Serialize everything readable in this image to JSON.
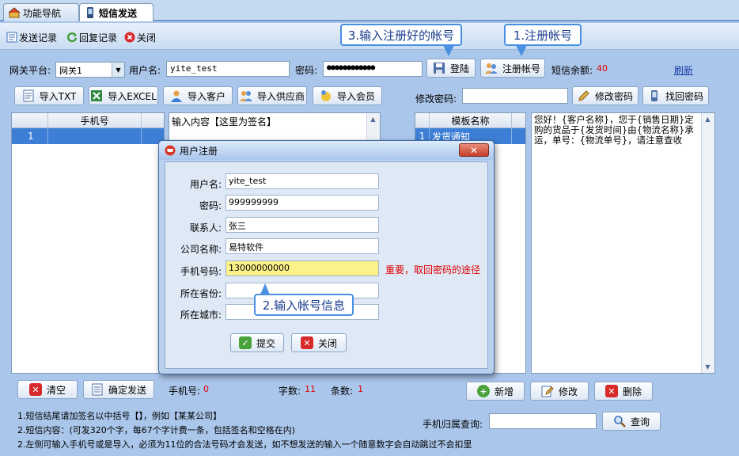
{
  "tabs": [
    {
      "label": "功能导航"
    },
    {
      "label": "短信发送"
    }
  ],
  "toolbar": {
    "send_log": "发送记录",
    "reply_log": "回复记录",
    "close": "关闭"
  },
  "gateway": {
    "label": "网关平台:",
    "value": "网关1",
    "user_label": "用户名:",
    "user_value": "yite_test",
    "pwd_label": "密码:",
    "pwd_value": "●●●●●●●●●●●●",
    "login": "登陆",
    "register": "注册帐号",
    "balance_label": "短信余额:",
    "balance_value": "40",
    "refresh": "刷新"
  },
  "import": {
    "txt": "导入TXT",
    "excel": "导入EXCEL",
    "customer": "导入客户",
    "supplier": "导入供应商",
    "member": "导入会员",
    "change_pwd_label": "修改密码:",
    "change_pwd": "修改密码",
    "find_pwd": "找回密码"
  },
  "phone_grid": {
    "header": "手机号",
    "row_index": "1"
  },
  "content": {
    "placeholder_text": "输入内容【这里为签名】"
  },
  "template_grid": {
    "header": "模板名称",
    "row_index": "1",
    "row_name": "发货通知"
  },
  "template_text": "您好！{客户名称}，您于{销售日期}定购的货品于{发货时间}由{物流名称}承运，单号：{物流单号}，请注意查收",
  "callouts": {
    "c1": "1.注册帐号",
    "c2": "2.输入帐号信息",
    "c3": "3.输入注册好的帐号"
  },
  "dialog": {
    "title": "用户注册",
    "fields": [
      {
        "label": "用户名:",
        "value": "yite_test"
      },
      {
        "label": "密码:",
        "value": "999999999"
      },
      {
        "label": "联系人:",
        "value": "张三"
      },
      {
        "label": "公司名称:",
        "value": "易特软件"
      },
      {
        "label": "手机号码:",
        "value": "13000000000"
      },
      {
        "label": "所在省份:",
        "value": ""
      },
      {
        "label": "所在城市:",
        "value": ""
      }
    ],
    "phone_hint": "重要，取回密码的途径",
    "submit": "提交",
    "close": "关闭"
  },
  "bottom": {
    "clear": "清空",
    "send": "确定发送",
    "phone_count_label": "手机号:",
    "phone_count": "0",
    "char_label": "字数:",
    "char_count": "11",
    "msg_label": "条数:",
    "msg_count": "1",
    "add": "新增",
    "edit": "修改",
    "delete": "删除",
    "lookup_label": "手机归属查询:",
    "lookup": "查询",
    "tip1": "1.短信结尾请加签名以中括号【】，例如【某某公司】",
    "tip2": "2.短信内容：(可发320个字，每67个字计费一条，包括签名和空格在内)",
    "tip3": "2.左侧可输入手机号或是导入，必须为11位的合法号码才会发送，如不想发送的输入一个随意数字会自动跳过不会扣里"
  },
  "colors": {
    "accent": "#3d7fd6",
    "warning": "#e00000",
    "background": "#aac6ea"
  }
}
